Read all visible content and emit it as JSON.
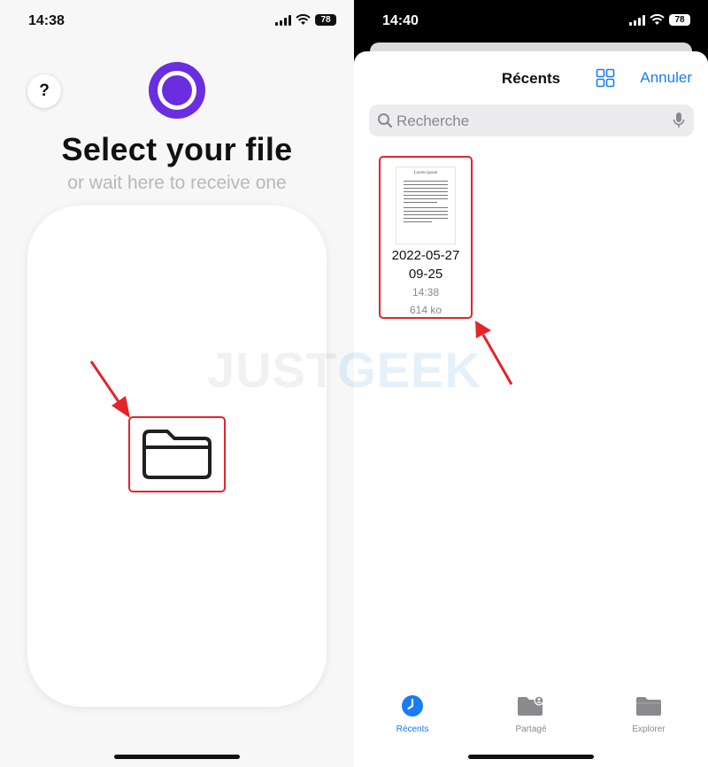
{
  "left_screen": {
    "status_time": "14:38",
    "battery": "78",
    "help_label": "?",
    "heading": "Select your file",
    "subheading": "or wait here to receive one"
  },
  "right_screen": {
    "status_time": "14:40",
    "battery": "78",
    "title": "Récents",
    "cancel_label": "Annuler",
    "search_placeholder": "Recherche",
    "file": {
      "thumb_title": "Lorem ipsum",
      "name_line1": "2022-05-27",
      "name_line2": "09-25",
      "time": "14:38",
      "size": "614 ko"
    },
    "tabs": [
      {
        "label": "Récents",
        "icon": "clock-icon"
      },
      {
        "label": "Partagé",
        "icon": "shared-folder-icon"
      },
      {
        "label": "Explorer",
        "icon": "folder-icon"
      }
    ]
  },
  "watermark": {
    "part1": "JUST",
    "part2": "GEEK"
  },
  "colors": {
    "accent_purple": "#6a2de0",
    "ios_blue": "#1a7cf5",
    "highlight_red": "#e3242b"
  }
}
